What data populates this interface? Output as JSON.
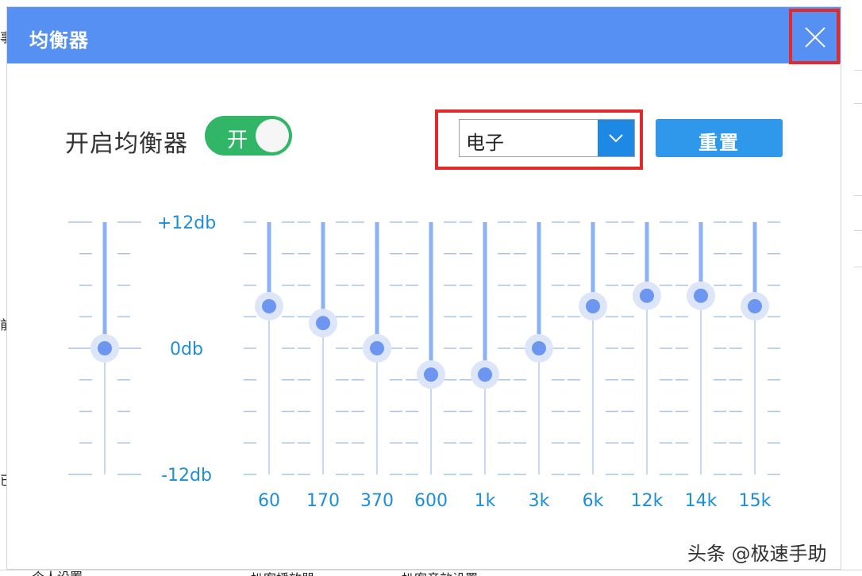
{
  "background": {
    "left_glyphs": [
      "事",
      "前",
      "已"
    ],
    "bottom_texts": [
      "个人设置",
      "扒客播放器",
      "扒客音效设置"
    ]
  },
  "dialog": {
    "title": "均衡器",
    "close_icon": "close-icon",
    "equalizer_label": "开启均衡器",
    "toggle": {
      "label": "开",
      "on": true
    },
    "preset": {
      "value": "电子",
      "arrow_icon": "chevron-down-icon"
    },
    "reset_label": "重置"
  },
  "scale": {
    "top": "+12db",
    "middle": "0db",
    "bottom": "-12db"
  },
  "preamp": {
    "value_db": 0
  },
  "bands": [
    {
      "label": "60",
      "value_db": 4
    },
    {
      "label": "170",
      "value_db": 2.4
    },
    {
      "label": "370",
      "value_db": 0
    },
    {
      "label": "600",
      "value_db": -2.5
    },
    {
      "label": "1k",
      "value_db": -2.5
    },
    {
      "label": "3k",
      "value_db": 0
    },
    {
      "label": "6k",
      "value_db": 4
    },
    {
      "label": "12k",
      "value_db": 5
    },
    {
      "label": "14k",
      "value_db": 5
    },
    {
      "label": "15k",
      "value_db": 4
    }
  ],
  "colors": {
    "titlebar": "#5590f2",
    "toggle_on": "#31b567",
    "accent": "#2f98ea",
    "highlight": "#e32a2a",
    "scale_text": "#1c8fd6",
    "slider": "#8db2f3",
    "knob": "#6c96ef"
  },
  "watermark": "头条 @极速手助"
}
